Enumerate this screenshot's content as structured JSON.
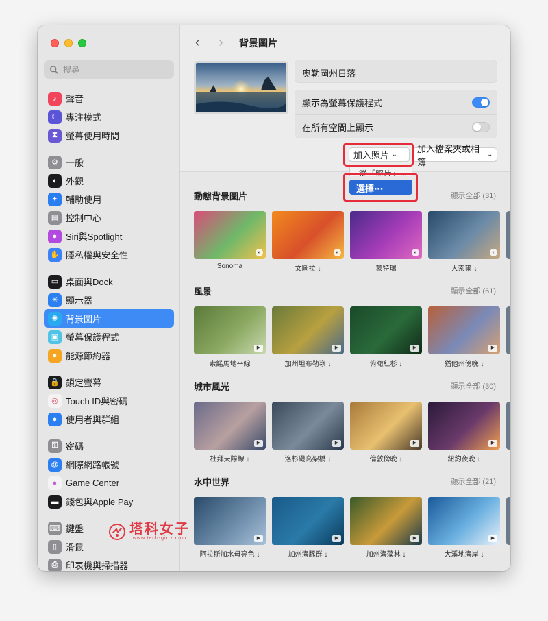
{
  "window": {
    "title": "背景圖片"
  },
  "search": {
    "placeholder": "搜尋"
  },
  "sidebar": {
    "groups": [
      [
        {
          "label": "聲音",
          "icon": "speaker-icon",
          "color": "#f0455a"
        },
        {
          "label": "專注模式",
          "icon": "moon-icon",
          "color": "#5b54d6"
        },
        {
          "label": "螢幕使用時間",
          "icon": "hourglass-icon",
          "color": "#6a57d4"
        }
      ],
      [
        {
          "label": "一般",
          "icon": "gear-icon",
          "color": "#8e8e93"
        },
        {
          "label": "外觀",
          "icon": "appearance-icon",
          "color": "#1c1c1e"
        },
        {
          "label": "輔助使用",
          "icon": "accessibility-icon",
          "color": "#2a7ff0"
        },
        {
          "label": "控制中心",
          "icon": "control-center-icon",
          "color": "#8e8e93"
        },
        {
          "label": "Siri與Spotlight",
          "icon": "siri-icon",
          "color": "#b24adf"
        },
        {
          "label": "隱私權與安全性",
          "icon": "hand-icon",
          "color": "#3a82f6"
        }
      ],
      [
        {
          "label": "桌面與Dock",
          "icon": "dock-icon",
          "color": "#1c1c1e"
        },
        {
          "label": "顯示器",
          "icon": "sun-icon",
          "color": "#2b7ff0"
        },
        {
          "label": "背景圖片",
          "icon": "wallpaper-icon",
          "color": "#29a9f0",
          "active": true
        },
        {
          "label": "螢幕保護程式",
          "icon": "screensaver-icon",
          "color": "#4fc4e6"
        },
        {
          "label": "能源節約器",
          "icon": "bulb-icon",
          "color": "#f4a623"
        }
      ],
      [
        {
          "label": "鎖定螢幕",
          "icon": "lock-icon",
          "color": "#1c1c1e"
        },
        {
          "label": "Touch ID與密碼",
          "icon": "fingerprint-icon",
          "color": "#f3f3f3"
        },
        {
          "label": "使用者與群組",
          "icon": "users-icon",
          "color": "#2b7ff0"
        }
      ],
      [
        {
          "label": "密碼",
          "icon": "key-icon",
          "color": "#8e8e93"
        },
        {
          "label": "網際網路帳號",
          "icon": "at-icon",
          "color": "#2b7ff0"
        },
        {
          "label": "Game Center",
          "icon": "game-center-icon",
          "color": "#f3f3f3"
        },
        {
          "label": "錢包與Apple Pay",
          "icon": "wallet-icon",
          "color": "#1c1c1e"
        }
      ],
      [
        {
          "label": "鍵盤",
          "icon": "keyboard-icon",
          "color": "#8e8e93"
        },
        {
          "label": "滑鼠",
          "icon": "mouse-icon",
          "color": "#8e8e93"
        },
        {
          "label": "印表機與掃描器",
          "icon": "printer-icon",
          "color": "#8e8e93"
        }
      ]
    ]
  },
  "header": {
    "back_icon": "chevron-left-icon",
    "forward_icon": "chevron-right-icon",
    "title": "背景圖片"
  },
  "current": {
    "name": "奧勒岡州日落",
    "toggle_screensaver_label": "顯示為螢幕保護程式",
    "toggle_screensaver_on": true,
    "toggle_all_spaces_label": "在所有空間上顯示",
    "toggle_all_spaces_on": false
  },
  "actions": {
    "add_photo": "加入照片",
    "add_folder": "加入檔案夾或相簿",
    "dropdown_ghost": "從「照片」...",
    "choose": "選擇⋯"
  },
  "sections": [
    {
      "title": "動態背景圖片",
      "show_all": "顯示全部 (31)",
      "items": [
        "Sonoma",
        "文圖拉 ↓",
        "蒙特瑞",
        "大索爾 ↓"
      ]
    },
    {
      "title": "風景",
      "show_all": "顯示全部 (61)",
      "items": [
        "索諾馬地平線",
        "加州坦布勒嶺 ↓",
        "俯瞰紅杉 ↓",
        "猶他州傍晚 ↓"
      ]
    },
    {
      "title": "城市風光",
      "show_all": "顯示全部 (30)",
      "items": [
        "杜拜天際線 ↓",
        "洛杉磯高架橋 ↓",
        "倫敦傍晚 ↓",
        "紐約夜晚 ↓"
      ]
    },
    {
      "title": "水中世界",
      "show_all": "顯示全部 (21)",
      "items": [
        "阿拉斯加水母亮色 ↓",
        "加州海豚群 ↓",
        "加州海藻林 ↓",
        "大溪地海岸 ↓"
      ]
    }
  ],
  "watermark": {
    "text": "塔科女子",
    "sub": "www.tech-girlz.com"
  }
}
